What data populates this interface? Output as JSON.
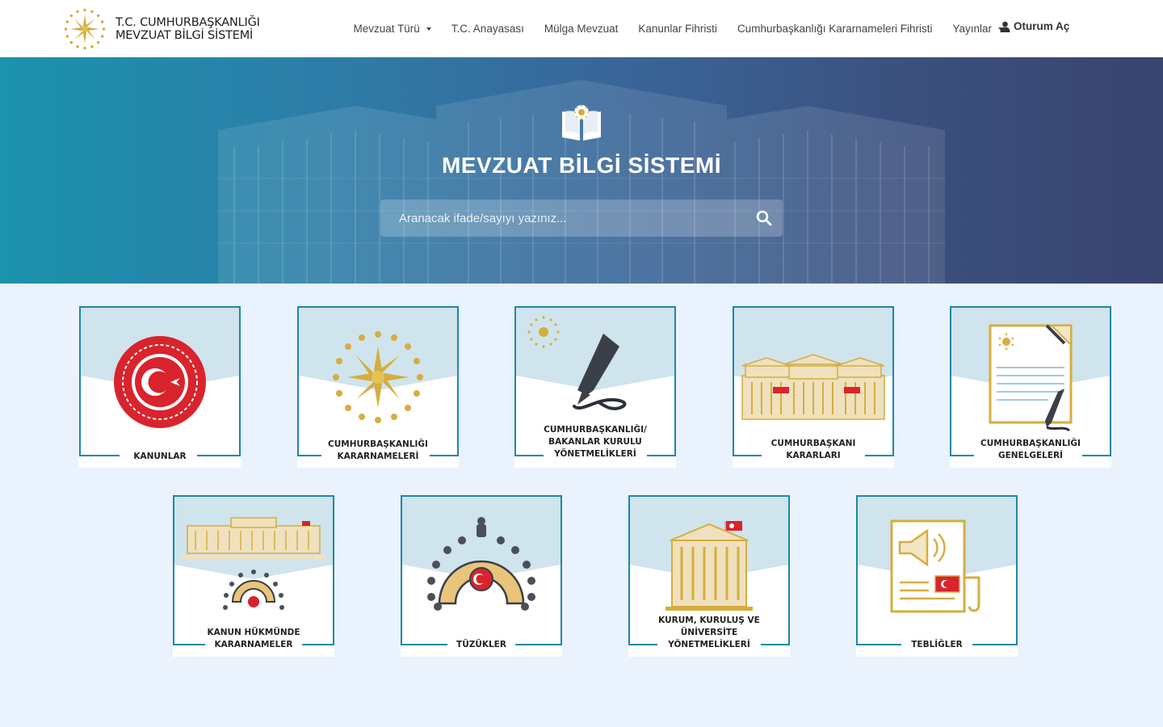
{
  "header": {
    "brand_line1": "T.C. CUMHURBAŞKANLIĞI",
    "brand_line2": "MEVZUAT BİLGİ SİSTEMİ",
    "nav": [
      {
        "label": "Mevzuat Türü",
        "dropdown": true
      },
      {
        "label": "T.C. Anayasası",
        "dropdown": false
      },
      {
        "label": "Mülga Mevzuat",
        "dropdown": false
      },
      {
        "label": "Kanunlar Fihristi",
        "dropdown": false
      },
      {
        "label": "Cumhurbaşkanlığı Kararnameleri Fihristi",
        "dropdown": false
      },
      {
        "label": "Yayınlar",
        "dropdown": true
      }
    ],
    "login_label": "Oturum Aç"
  },
  "hero": {
    "title": "MEVZUAT BİLGİ SİSTEMİ",
    "search_placeholder": "Aranacak ifade/sayıyı yazınız..."
  },
  "cards": [
    {
      "lines": [
        "KANUNLAR"
      ],
      "icon": "parliament-seal-icon"
    },
    {
      "lines": [
        "CUMHURBAŞKANLIĞI",
        "KARARNAMELERİ"
      ],
      "icon": "presidential-seal-icon"
    },
    {
      "lines": [
        "CUMHURBAŞKANLIĞI/",
        "BAKANLAR KURULU",
        "YÖNETMELİKLERİ"
      ],
      "icon": "fountain-pen-icon"
    },
    {
      "lines": [
        "CUMHURBAŞKANI",
        "KARARLARI"
      ],
      "icon": "presidential-complex-icon"
    },
    {
      "lines": [
        "CUMHURBAŞKANLIĞI",
        "GENELGELERİ"
      ],
      "icon": "circular-document-icon"
    },
    {
      "lines": [
        "KANUN HÜKMÜNDE",
        "KARARNAMELER"
      ],
      "icon": "assembly-hall-icon"
    },
    {
      "lines": [
        "TÜZÜKLER"
      ],
      "icon": "assembly-seating-icon"
    },
    {
      "lines": [
        "KURUM, KURULUŞ VE",
        "ÜNİVERSİTE",
        "YÖNETMELİKLERİ"
      ],
      "icon": "institution-building-icon"
    },
    {
      "lines": [
        "TEBLİĞLER"
      ],
      "icon": "announcement-icon"
    }
  ],
  "colors": {
    "accent_teal": "#1b88a7",
    "gold": "#d6ad3f",
    "red": "#d9232d",
    "page_bg": "#eaf2fd"
  }
}
